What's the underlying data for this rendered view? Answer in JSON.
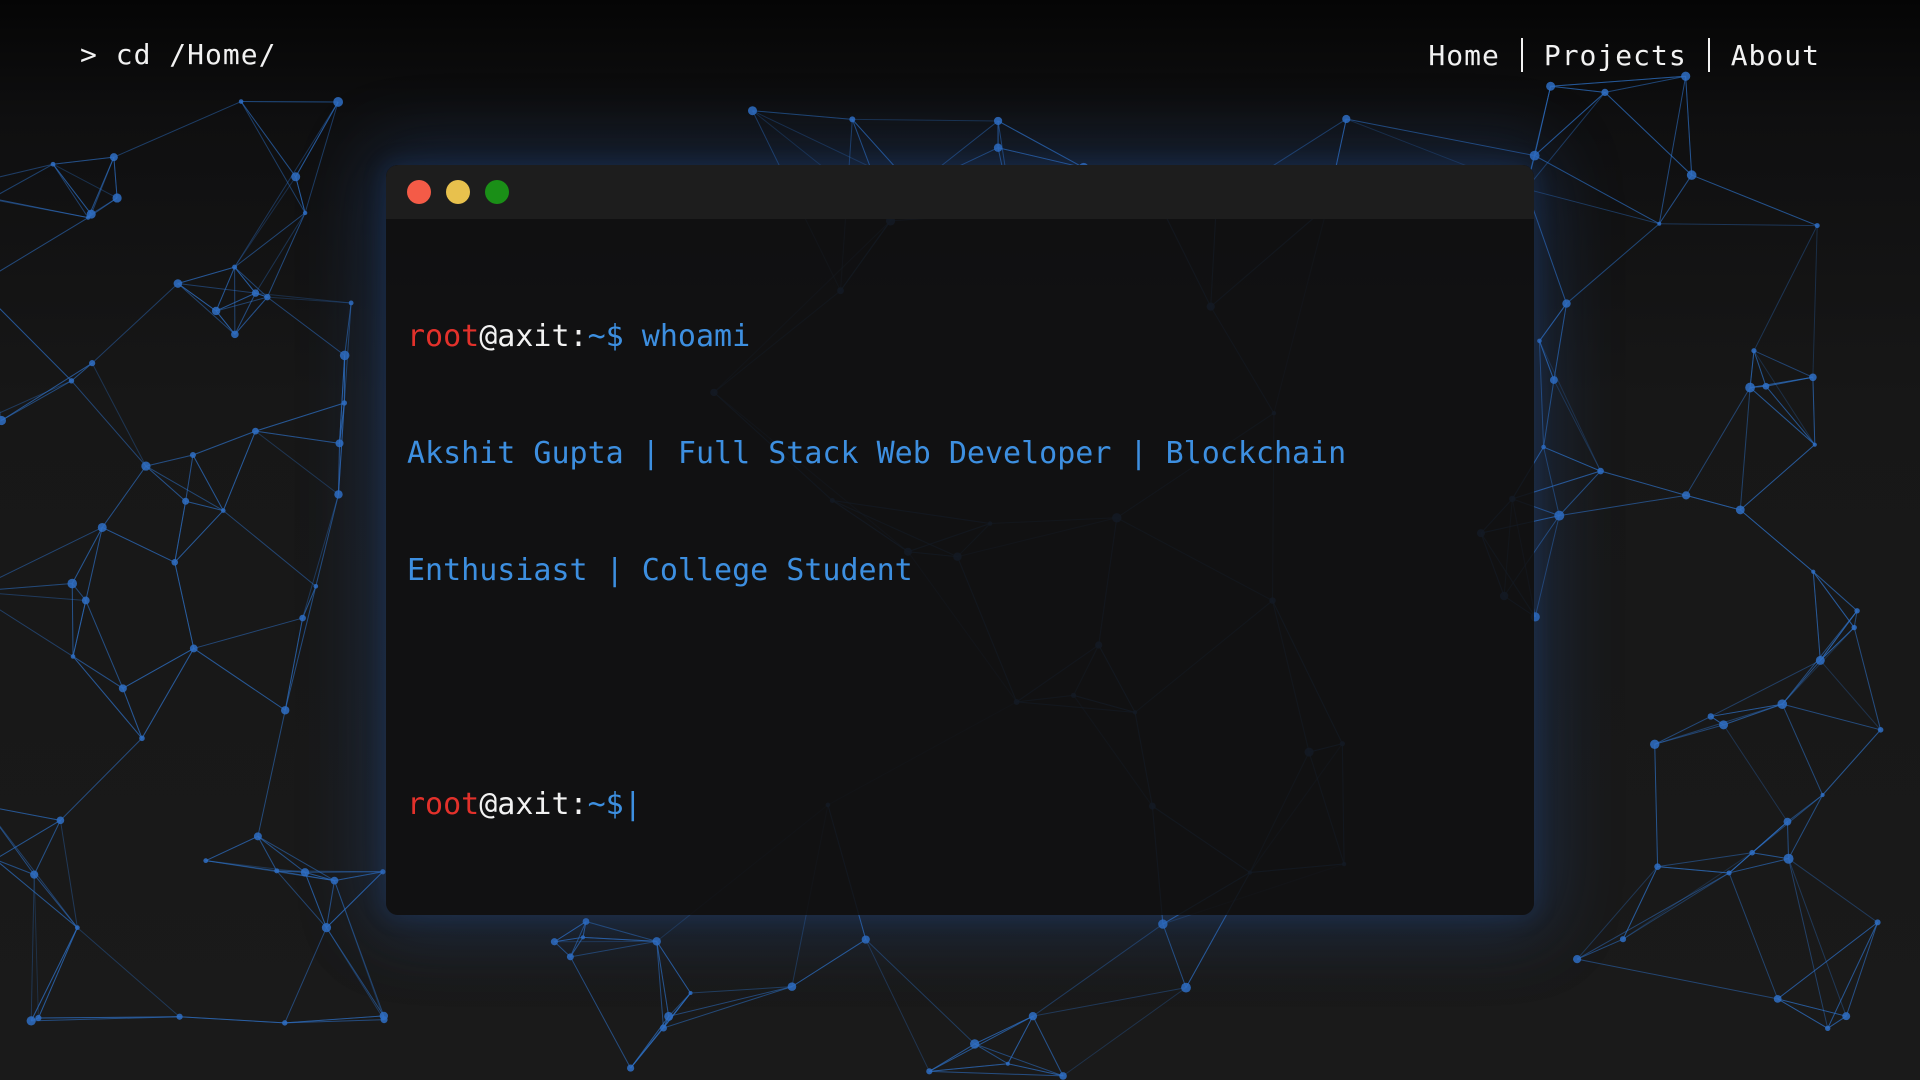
{
  "header": {
    "path": "> cd /Home/",
    "nav": [
      {
        "label": "Home"
      },
      {
        "label": "Projects"
      },
      {
        "label": "About"
      }
    ]
  },
  "terminal": {
    "lines": [
      {
        "user": "root",
        "host": "@axit:",
        "path": "~$",
        "command": " whoami"
      },
      {
        "output": "Akshit Gupta | Full Stack Web Developer | Blockchain"
      },
      {
        "output": "Enthusiast | College Student"
      },
      {
        "user": "root",
        "host": "@axit:",
        "path": "~$",
        "cursor": "|"
      }
    ]
  },
  "colors": {
    "background": "#161616",
    "accent": "#3d8fe0",
    "prompt_user": "#e3312b",
    "close": "#f45b47",
    "minimize": "#e8c14d",
    "maximize": "#1a8f17"
  }
}
